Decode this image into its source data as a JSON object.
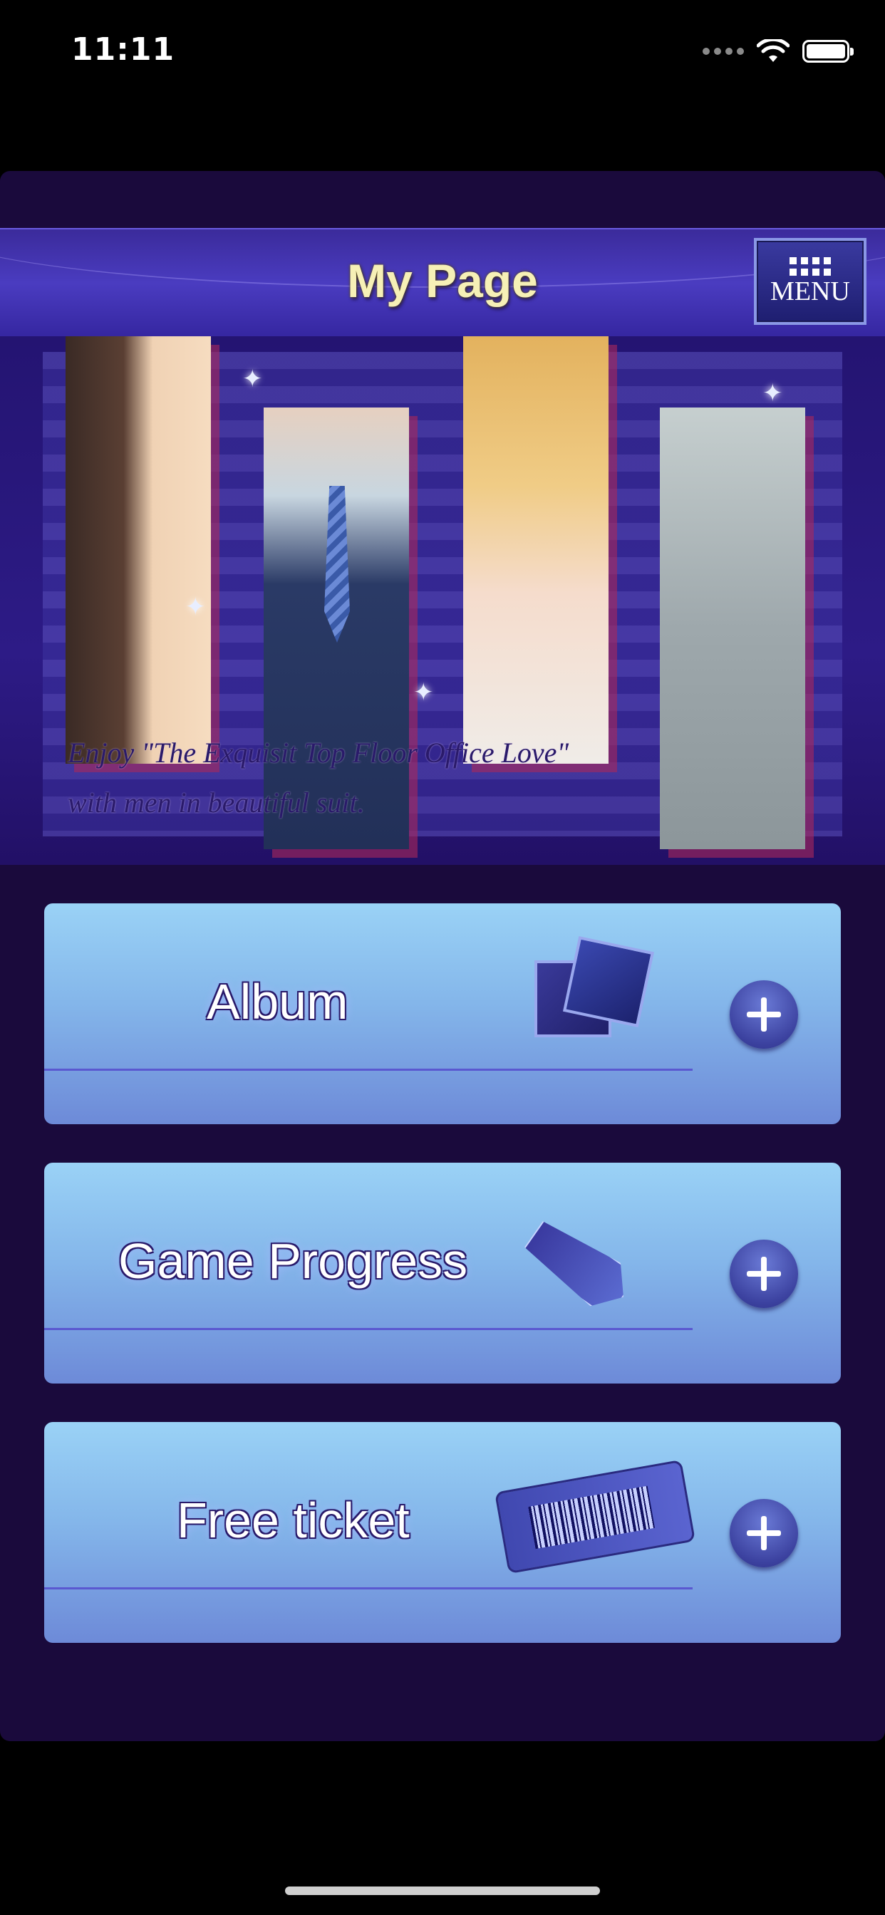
{
  "status_bar": {
    "time": "11:11"
  },
  "header": {
    "title": "My Page",
    "menu_label": "MENU"
  },
  "banner": {
    "caption_line1": "Enjoy \"The Exquisit Top Floor Office Love\"",
    "caption_line2": "with men in beautiful suit."
  },
  "menu_cards": [
    {
      "label": "Album",
      "icon": "album-icon"
    },
    {
      "label": "Game Progress",
      "icon": "necktie-icon"
    },
    {
      "label": "Free ticket",
      "icon": "ticket-icon"
    }
  ],
  "colors": {
    "background": "#1a0a3c",
    "header": "#4a3cc0",
    "card_top": "#9ad2f6",
    "card_bottom": "#6d8ad8",
    "title_text": "#f6f0b6"
  }
}
